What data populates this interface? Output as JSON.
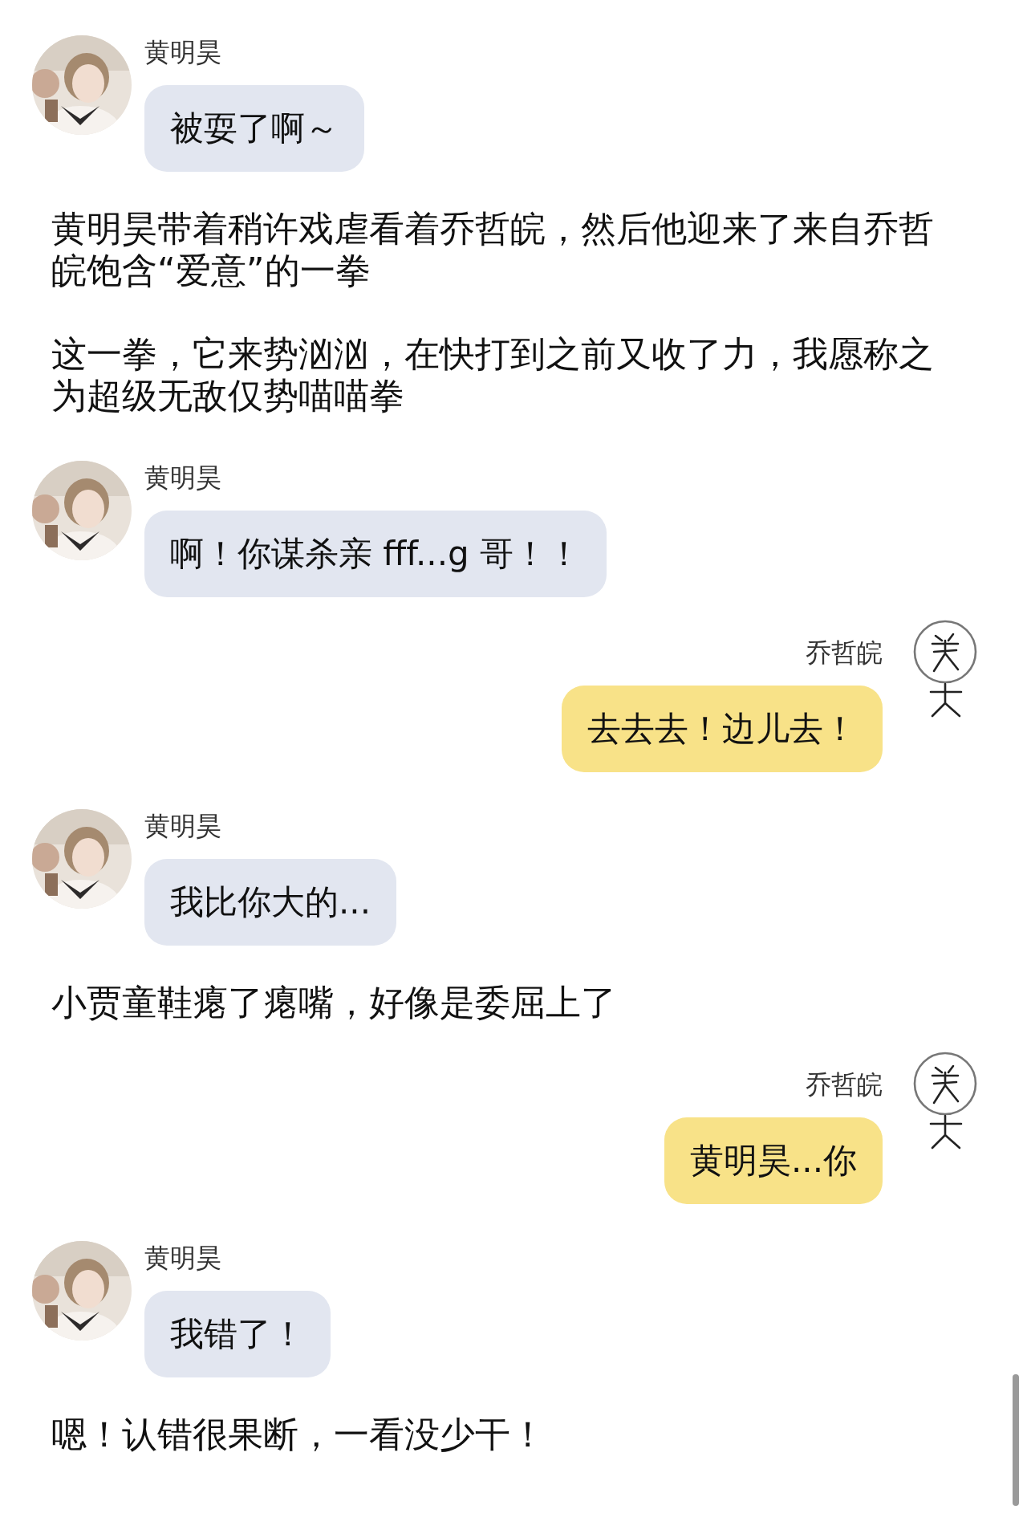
{
  "items": [
    {
      "kind": "received",
      "sender": "黄明昊",
      "text": "被耍了啊～"
    },
    {
      "kind": "narration",
      "text": "黄明昊带着稍许戏虐看着乔哲皖，然后他迎来了来自乔哲皖饱含“爱意”的一拳"
    },
    {
      "kind": "narration",
      "text": "这一拳，它来势汹汹，在快打到之前又收了力，我愿称之为超级无敌仅势喵喵拳"
    },
    {
      "kind": "received",
      "sender": "黄明昊",
      "text": "啊！你谋杀亲 fff...g 哥！！"
    },
    {
      "kind": "sent",
      "sender": "乔哲皖",
      "text": "去去去！边儿去！"
    },
    {
      "kind": "received",
      "sender": "黄明昊",
      "text": "我比你大的..."
    },
    {
      "kind": "narration",
      "text": "小贾童鞋瘪了瘪嘴，好像是委屈上了"
    },
    {
      "kind": "sent",
      "sender": "乔哲皖",
      "text": "黄明昊...你"
    },
    {
      "kind": "received",
      "sender": "黄明昊",
      "text": "我错了！"
    },
    {
      "kind": "narration",
      "text": "嗯！认错很果断，一看没少干！"
    }
  ]
}
